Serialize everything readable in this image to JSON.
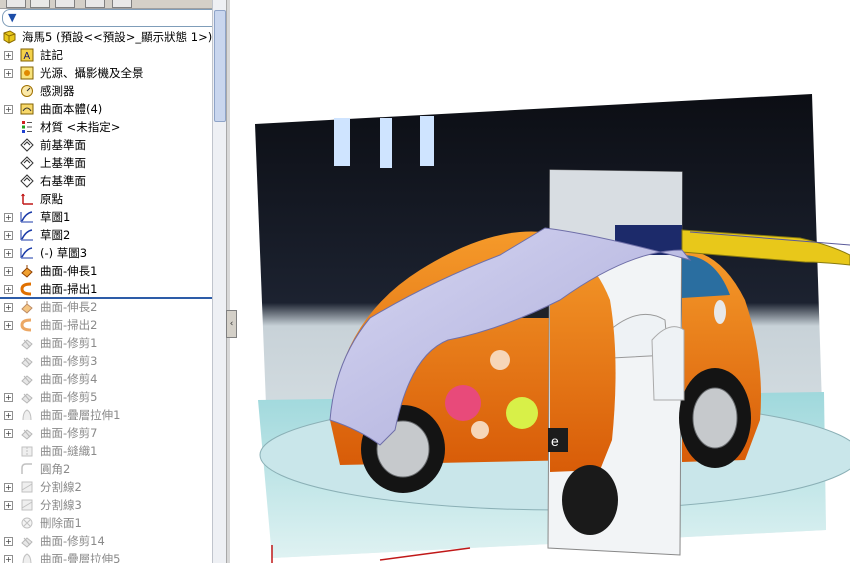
{
  "tree": {
    "root_label": "海馬5 (預設<<預設>_顯示狀態 1>)",
    "items": [
      {
        "label": "註記",
        "icon": "annotation-icon",
        "expand": true,
        "dim": false
      },
      {
        "label": "光源、攝影機及全景",
        "icon": "lights-camera-icon",
        "expand": true,
        "dim": false
      },
      {
        "label": "感測器",
        "icon": "sensor-icon",
        "expand": false,
        "dim": false
      },
      {
        "label": "曲面本體(4)",
        "icon": "surface-bodies-icon",
        "expand": true,
        "dim": false
      },
      {
        "label": "材質 <未指定>",
        "icon": "material-icon",
        "expand": false,
        "dim": false
      },
      {
        "label": "前基準面",
        "icon": "plane-icon",
        "expand": false,
        "dim": false
      },
      {
        "label": "上基準面",
        "icon": "plane-icon",
        "expand": false,
        "dim": false
      },
      {
        "label": "右基準面",
        "icon": "plane-icon",
        "expand": false,
        "dim": false
      },
      {
        "label": "原點",
        "icon": "origin-icon",
        "expand": false,
        "dim": false
      },
      {
        "label": "草圖1",
        "icon": "sketch-icon",
        "expand": true,
        "dim": false
      },
      {
        "label": "草圖2",
        "icon": "sketch-icon",
        "expand": true,
        "dim": false
      },
      {
        "label": "(-) 草圖3",
        "icon": "sketch-icon",
        "expand": true,
        "dim": false
      },
      {
        "label": "曲面-伸長1",
        "icon": "surface-extrude-icon",
        "expand": true,
        "dim": false
      },
      {
        "label": "曲面-掃出1",
        "icon": "surface-sweep-icon",
        "expand": true,
        "dim": false
      },
      {
        "label": "曲面-伸長2",
        "icon": "surface-extrude-icon",
        "expand": true,
        "dim": true
      },
      {
        "label": "曲面-掃出2",
        "icon": "surface-sweep-icon",
        "expand": true,
        "dim": true
      },
      {
        "label": "曲面-修剪1",
        "icon": "surface-trim-icon",
        "expand": false,
        "dim": true
      },
      {
        "label": "曲面-修剪3",
        "icon": "surface-trim-icon",
        "expand": false,
        "dim": true
      },
      {
        "label": "曲面-修剪4",
        "icon": "surface-trim-icon",
        "expand": false,
        "dim": true
      },
      {
        "label": "曲面-修剪5",
        "icon": "surface-trim-icon",
        "expand": true,
        "dim": true
      },
      {
        "label": "曲面-疊層拉伸1",
        "icon": "surface-loft-icon",
        "expand": true,
        "dim": true
      },
      {
        "label": "曲面-修剪7",
        "icon": "surface-trim-icon",
        "expand": true,
        "dim": true
      },
      {
        "label": "曲面-縫織1",
        "icon": "surface-knit-icon",
        "expand": false,
        "dim": true
      },
      {
        "label": "圓角2",
        "icon": "fillet-icon",
        "expand": false,
        "dim": true
      },
      {
        "label": "分割線2",
        "icon": "split-line-icon",
        "expand": true,
        "dim": true
      },
      {
        "label": "分割線3",
        "icon": "split-line-icon",
        "expand": true,
        "dim": true
      },
      {
        "label": "刪除面1",
        "icon": "delete-face-icon",
        "expand": false,
        "dim": true
      },
      {
        "label": "曲面-修剪14",
        "icon": "surface-trim-icon",
        "expand": true,
        "dim": true
      },
      {
        "label": "曲面-疊層拉伸5",
        "icon": "surface-loft-icon",
        "expand": true,
        "dim": true
      }
    ]
  },
  "viewport": {
    "texture_text": "e"
  },
  "colors": {
    "car_orange": "#f07a14",
    "surface_lavender": "#c8c8ea",
    "surface_yellow": "#e8c81a",
    "rollback_bar": "#2d5ca8"
  }
}
